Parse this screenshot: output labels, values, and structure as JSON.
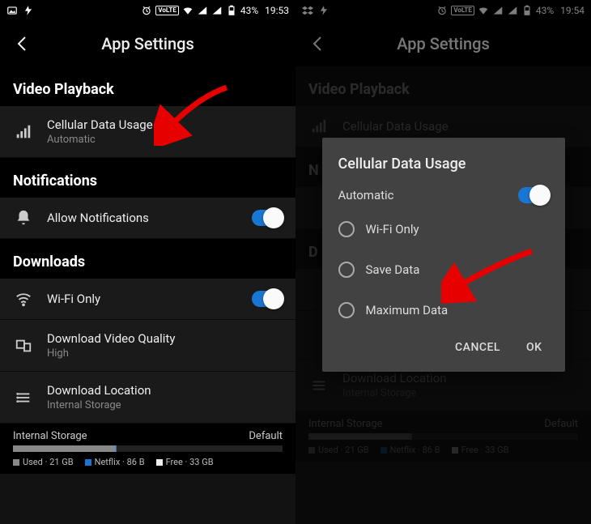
{
  "colors": {
    "accent": "#1976d2"
  },
  "left": {
    "status": {
      "battery": "43%",
      "time": "19:53",
      "volte": "VoLTE"
    },
    "header": {
      "title": "App Settings"
    },
    "sections": {
      "video": {
        "title": "Video Playback",
        "cellular": {
          "title": "Cellular Data Usage",
          "sub": "Automatic"
        }
      },
      "notifications": {
        "title": "Notifications",
        "allow": {
          "title": "Allow Notifications",
          "on": true
        }
      },
      "downloads": {
        "title": "Downloads",
        "wifi": {
          "title": "Wi-Fi Only",
          "on": true
        },
        "quality": {
          "title": "Download Video Quality",
          "sub": "High"
        },
        "location": {
          "title": "Download Location",
          "sub": "Internal Storage"
        }
      }
    },
    "storage": {
      "label": "Internal Storage",
      "default": "Default",
      "used": "Used · 21 GB",
      "netflix": "Netflix · 86 B",
      "free": "Free · 33 GB"
    }
  },
  "right": {
    "status": {
      "battery": "43%",
      "time": "19:54",
      "volte": "VoLTE"
    },
    "header": {
      "title": "App Settings"
    },
    "sections": {
      "video": {
        "title": "Video Playback",
        "cellular": {
          "title": "Cellular Data Usage"
        }
      },
      "notifications_prefix": "N",
      "downloads_prefix": "D",
      "downloads": {
        "location": {
          "title": "Download Location",
          "sub": "Internal Storage"
        }
      }
    },
    "storage": {
      "label": "Internal Storage",
      "default": "Default",
      "used": "Used · 21 GB",
      "netflix": "Netflix · 86 B",
      "free": "Free · 33 GB"
    },
    "modal": {
      "title": "Cellular Data Usage",
      "automatic": "Automatic",
      "auto_on": true,
      "options": [
        "Wi-Fi Only",
        "Save Data",
        "Maximum Data"
      ],
      "cancel": "CANCEL",
      "ok": "OK"
    }
  }
}
